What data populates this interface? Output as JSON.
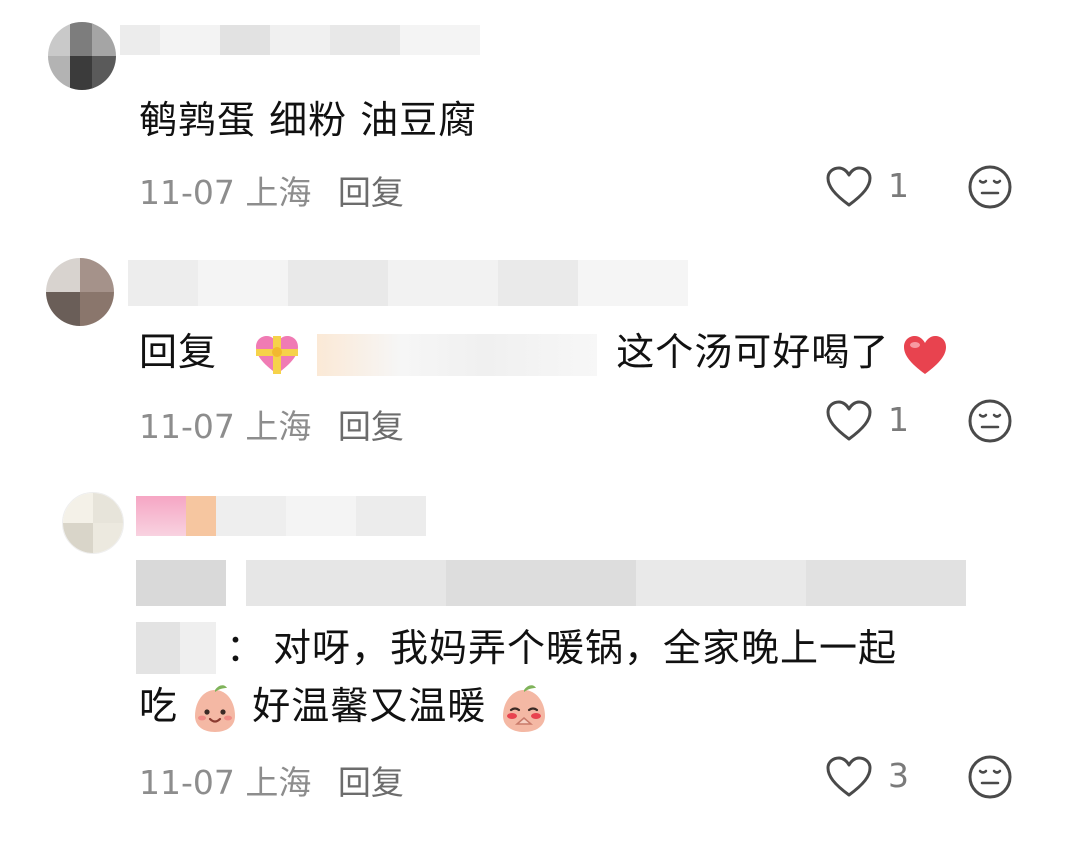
{
  "comments": [
    {
      "text": "鹌鹑蛋 细粉 油豆腐",
      "date": "11-07",
      "location": "上海",
      "reply": "回复",
      "likes": "1"
    },
    {
      "reply_prefix": "回复",
      "text": "这个汤可好喝了",
      "date": "11-07",
      "location": "上海",
      "reply": "回复",
      "likes": "1"
    },
    {
      "colon": "：",
      "line1": "对呀，我妈弄个暖锅，全家晚上一起",
      "line2_a": "吃",
      "line2_b": "好温馨又温暖",
      "date": "11-07",
      "location": "上海",
      "reply": "回复",
      "likes": "3"
    }
  ],
  "icons": {
    "like": "heart-outline-icon",
    "dislike": "neutral-face-icon",
    "gift_heart": "heart-with-ribbon-emoji",
    "red_heart": "red-heart-emoji",
    "peach_smile": "peach-smile-emoji",
    "peach_shy": "peach-shy-emoji"
  },
  "colors": {
    "meta": "#8d8d8d",
    "text": "#111111",
    "heart_red": "#e8434f"
  }
}
